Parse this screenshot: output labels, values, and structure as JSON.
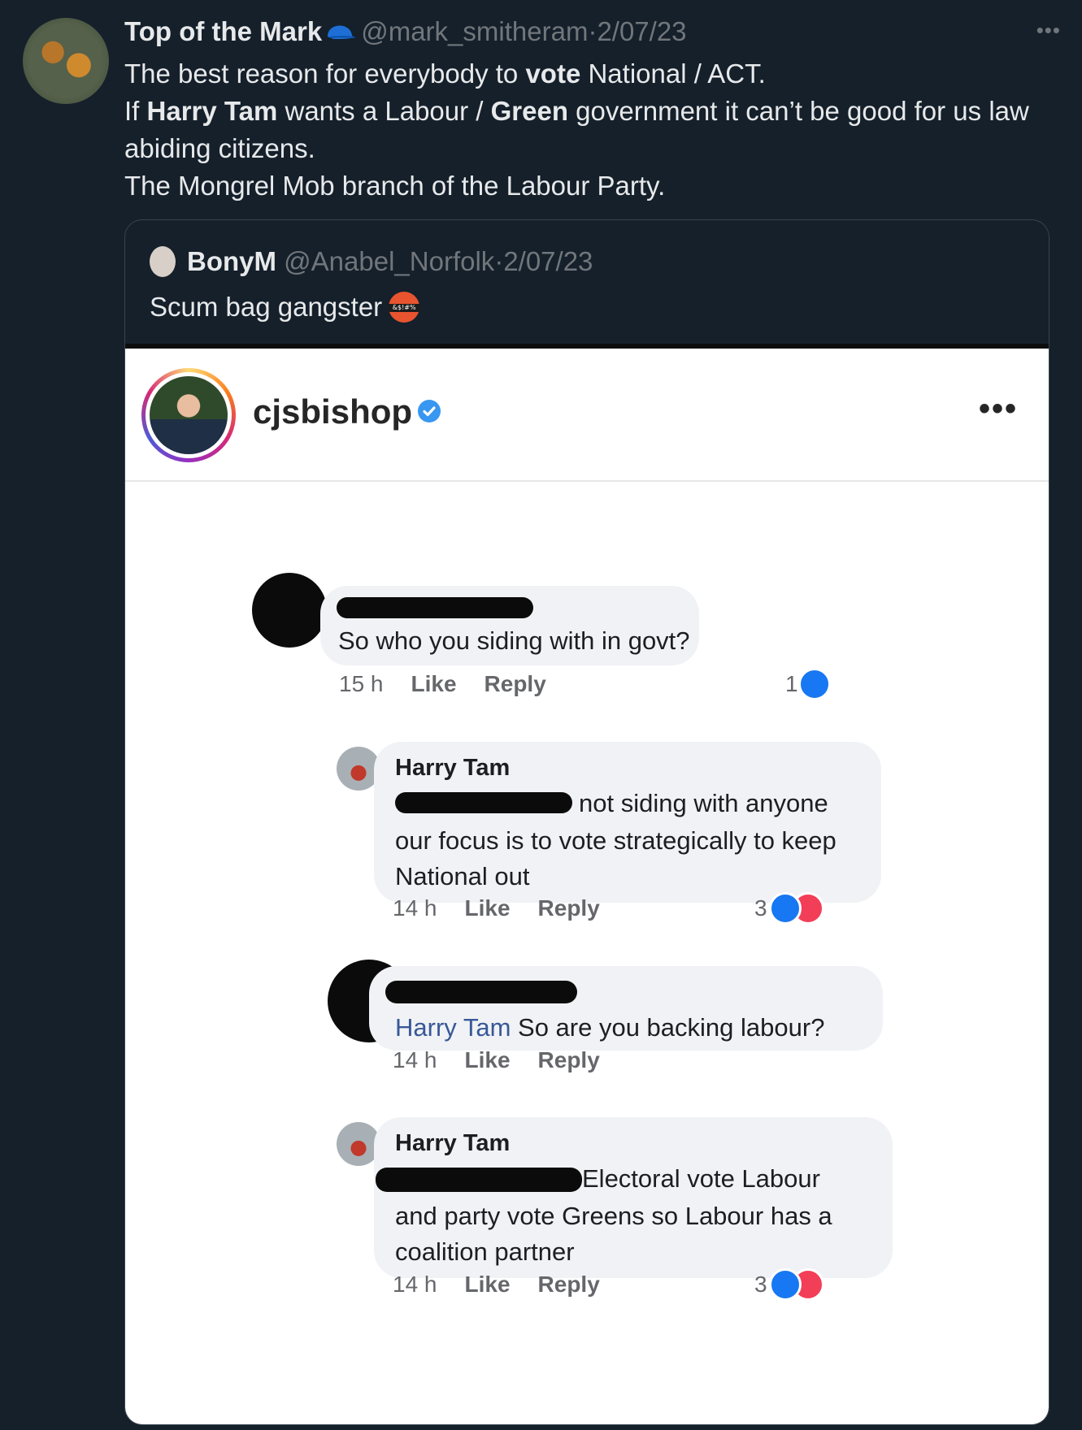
{
  "tweet": {
    "display_name": "Top of the Mark",
    "handle": "@mark_smitheram",
    "separator": "·",
    "date": "2/07/23",
    "lines": [
      {
        "a": "The best reason for everybody to ",
        "b": "vote",
        "c": " National / ACT."
      },
      {
        "a": "If ",
        "b": "Harry Tam",
        "c": " wants a Labour / ",
        "d": "Green",
        "e": " government it can’t be good for us law abiding citizens."
      },
      {
        "a": "The Mongrel Mob branch of the Labour Party."
      }
    ]
  },
  "quote": {
    "display_name": "BonyM",
    "handle": "@Anabel_Norfolk",
    "separator": "·",
    "date": "2/07/23",
    "text": "Scum bag gangster",
    "emoji_text": "&$!#%"
  },
  "instagram": {
    "username": "cjsbishop",
    "more": "•••"
  },
  "comments": [
    {
      "text": "So who you siding with in govt?",
      "time": "15 h",
      "like": "Like",
      "reply": "Reply",
      "count": "1"
    },
    {
      "name": "Harry Tam",
      "text_line1": "not siding with anyone",
      "text_rest": "our focus is to vote strategically to keep National out",
      "time": "14 h",
      "like": "Like",
      "reply": "Reply",
      "count": "3"
    },
    {
      "mention": "Harry Tam",
      "text": " So are you backing labour?",
      "time": "14 h",
      "like": "Like",
      "reply": "Reply"
    },
    {
      "name": "Harry Tam",
      "text_line1": "Electoral vote Labour",
      "text_rest": "and party vote Greens so Labour has a coalition partner",
      "time": "14 h",
      "like": "Like",
      "reply": "Reply",
      "count": "3"
    }
  ],
  "icons": {
    "more": "more-icon",
    "cap": "cap-icon",
    "verified": "verified-badge-icon",
    "like": "like-reaction-icon",
    "love": "love-reaction-icon"
  },
  "colors": {
    "background": "#15202b",
    "muted": "#71767b",
    "fb_link": "#385898",
    "fb_like": "#1877f2",
    "fb_love": "#f33e58"
  }
}
